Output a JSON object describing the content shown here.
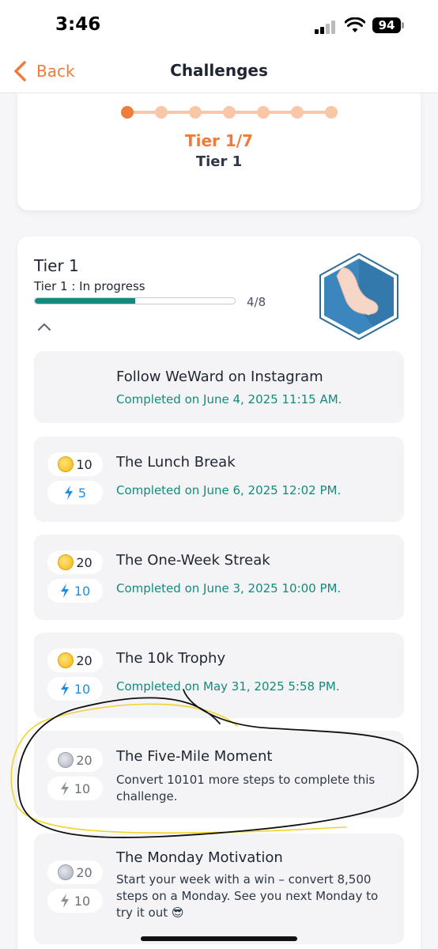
{
  "status_bar": {
    "time": "3:46",
    "battery": "94"
  },
  "nav": {
    "back_label": "Back",
    "title": "Challenges"
  },
  "tier_summary": {
    "progress_label": "Tier 1/7",
    "name": "Tier 1",
    "steps_total": 7,
    "steps_active": 1
  },
  "tier_section": {
    "title": "Tier 1",
    "status": "Tier 1 : In progress",
    "progress_count": "4/8",
    "progress_fraction": 0.5
  },
  "challenges": [
    {
      "title": "Follow WeWard on Instagram",
      "status": "Completed on June 4, 2025 11:15 AM.",
      "coins": "",
      "energy": ""
    },
    {
      "title": "The Lunch Break",
      "status": "Completed on June 6, 2025 12:02 PM.",
      "coins": "10",
      "energy": "5"
    },
    {
      "title": "The One-Week Streak",
      "status": "Completed on June 3, 2025 10:00 PM.",
      "coins": "20",
      "energy": "10"
    },
    {
      "title": "The 10k Trophy",
      "status": "Completed on May 31, 2025 5:58 PM.",
      "coins": "20",
      "energy": "10"
    },
    {
      "title": "The Five-Mile Moment",
      "status": "Convert 10101 more steps to complete this challenge.",
      "coins": "20",
      "energy": "10"
    },
    {
      "title": "The Monday Motivation",
      "status": "Start your week with a win – convert 8,500 steps on a Monday. See you next Monday to try it out 😎",
      "coins": "20",
      "energy": "10"
    }
  ],
  "colors": {
    "accent": "#ef7b3c",
    "completed": "#158a7c",
    "energy": "#1d8fe0"
  },
  "icons": [
    "back-chevron-icon",
    "collapse-chevron-icon",
    "foot-badge-icon",
    "coin-icon",
    "lightning-icon"
  ]
}
